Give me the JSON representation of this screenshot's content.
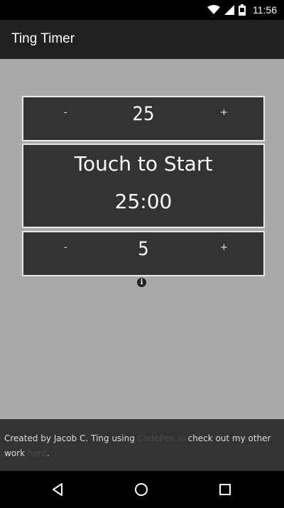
{
  "status_bar": {
    "time": "11:56",
    "icons": [
      "wifi-icon",
      "signal-icon",
      "battery-icon"
    ]
  },
  "app_bar": {
    "title": "Ting Timer"
  },
  "work_timer": {
    "minus_label": "-",
    "value": "25",
    "plus_label": "+"
  },
  "start_panel": {
    "label": "Touch to Start",
    "time": "25:00"
  },
  "break_timer": {
    "minus_label": "-",
    "value": "5",
    "plus_label": "+"
  },
  "info": {
    "icon": "info-icon",
    "glyph": "i"
  },
  "footer": {
    "prefix": "Created by Jacob C. Ting using ",
    "codepen_link": "CodePen.io",
    "middle": " check out my other work ",
    "here_link": "here",
    "suffix": "."
  },
  "nav_bar": {
    "icons": [
      "back-icon",
      "home-icon",
      "recents-icon"
    ]
  },
  "colors": {
    "background": "#a9a9a9",
    "app_bar": "#212121",
    "panel": "#333333",
    "border": "#e8e8e8",
    "link": "#4a4a4a"
  }
}
